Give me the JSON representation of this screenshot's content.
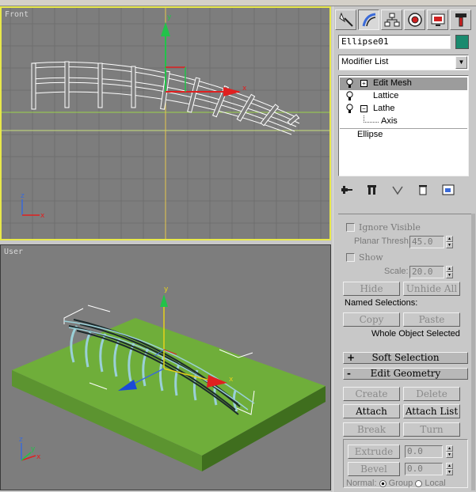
{
  "viewports": {
    "front": {
      "label": "Front"
    },
    "user": {
      "label": "User"
    }
  },
  "panel": {
    "tabs": [
      "create-icon",
      "modify-icon",
      "hierarchy-icon",
      "motion-icon",
      "display-icon",
      "utilities-icon"
    ],
    "object_name": "Ellipse01",
    "object_color": "#1a8a6e",
    "modifier_list": "Modifier List",
    "stack": [
      {
        "label": "Edit Mesh",
        "bulb": true,
        "expander": "+",
        "selected": true
      },
      {
        "label": "Lattice",
        "bulb": true,
        "expander": "",
        "selected": false
      },
      {
        "label": "Lathe",
        "bulb": true,
        "expander": "-",
        "selected": false
      },
      {
        "label": "Axis",
        "bulb": false,
        "expander": "",
        "selected": false
      },
      {
        "label": "Ellipse",
        "bulb": false,
        "expander": "",
        "selected": false
      }
    ],
    "selection": {
      "ignore_visible": "Ignore Visible",
      "planar_thresh_label": "Planar Thresh:",
      "planar_thresh_value": "45.0",
      "show_label": "Show",
      "scale_label": "Scale:",
      "scale_value": "20.0",
      "hide": "Hide",
      "unhide_all": "Unhide All",
      "named_selections": "Named Selections:",
      "copy": "Copy",
      "paste": "Paste",
      "whole_object": "Whole Object Selected"
    },
    "soft_selection": {
      "sign": "+",
      "title": "Soft Selection"
    },
    "edit_geometry": {
      "sign": "-",
      "title": "Edit Geometry",
      "create": "Create",
      "delete": "Delete",
      "attach": "Attach",
      "attach_list": "Attach List",
      "break": "Break",
      "turn": "Turn",
      "extrude": "Extrude",
      "extrude_value": "0.0",
      "bevel": "Bevel",
      "bevel_value": "0.0",
      "normal_label": "Normal:",
      "group": "Group",
      "local": "Local"
    }
  }
}
